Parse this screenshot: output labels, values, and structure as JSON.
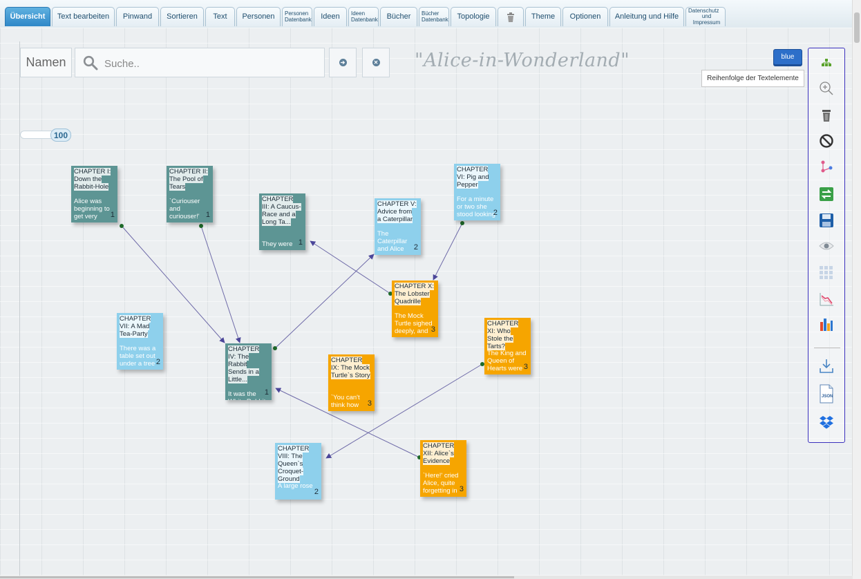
{
  "tabs": [
    {
      "label": "Übersicht",
      "active": true
    },
    {
      "label": "Text bearbeiten"
    },
    {
      "label": "Pinwand"
    },
    {
      "label": "Sortieren"
    },
    {
      "label": "Text"
    },
    {
      "label": "Personen"
    },
    {
      "label": "Personen",
      "label2": "Datenbank"
    },
    {
      "label": "Ideen"
    },
    {
      "label": "Ideen",
      "label2": "Datenbank"
    },
    {
      "label": "Bücher"
    },
    {
      "label": "Bücher",
      "label2": "Datenbank"
    },
    {
      "label": "Topologie"
    },
    {
      "icon": "trash-icon"
    },
    {
      "label": "Theme"
    },
    {
      "label": "Optionen"
    },
    {
      "label": "Anleitung und Hilfe"
    },
    {
      "label": "Datenschutz",
      "label2": "und Impressum"
    }
  ],
  "search": {
    "names_label": "Namen",
    "placeholder": "Suche.."
  },
  "document_title": "\"Alice-in-Wonderland\"",
  "theme_button": "blue",
  "tooltip": "Reihenfolge der Textelemente",
  "zoom": {
    "value": "100"
  },
  "toolbar": {
    "icons": [
      "hierarchy-icon",
      "zoom-in-icon",
      "trash-can-icon",
      "forbidden-icon",
      "graph-nodes-icon",
      "swap-icon",
      "save-icon",
      "eye-icon",
      "grid-icon",
      "chart-down-icon",
      "bar-chart-icon",
      "download-icon",
      "json-file-icon",
      "dropbox-icon"
    ]
  },
  "nodes": [
    {
      "id": "c1",
      "title": "CHAPTER I: Down the Rabbit-Hole",
      "excerpt": "Alice was beginning to get very",
      "num": "1",
      "color": "teal"
    },
    {
      "id": "c2",
      "title": "CHAPTER II: The Pool of Tears",
      "excerpt": "`Curiouser and curiouser!'",
      "num": "1",
      "color": "teal"
    },
    {
      "id": "c3",
      "title": "CHAPTER III: A Caucus-Race and a Long Ta...",
      "excerpt": "They were",
      "num": "1",
      "color": "teal"
    },
    {
      "id": "c4",
      "title": "CHAPTER IV: The Rabbit Sends in a Little...",
      "excerpt": "It was the White Rabbit,",
      "num": "1",
      "color": "teal"
    },
    {
      "id": "c5",
      "title": "CHAPTER V: Advice from a Caterpillar",
      "excerpt": "The Caterpillar and Alice",
      "num": "2",
      "color": "light"
    },
    {
      "id": "c6",
      "title": "CHAPTER VI: Pig and Pepper",
      "excerpt": "For a minute or two she stood looking",
      "num": "2",
      "color": "light"
    },
    {
      "id": "c7",
      "title": "CHAPTER VII: A Mad Tea-Party",
      "excerpt": "There was a table set out under a tree",
      "num": "2",
      "color": "light"
    },
    {
      "id": "c8",
      "title": "CHAPTER VIII: The Queen`s Croquet-Ground",
      "excerpt": "A large rose",
      "num": "2",
      "color": "light"
    },
    {
      "id": "c9",
      "title": "CHAPTER IX: The Mock Turtle`s Story",
      "excerpt": "`You can't think how",
      "num": "3",
      "color": "orange"
    },
    {
      "id": "c10",
      "title": "CHAPTER X: The Lobster Quadrille",
      "excerpt": "The Mock Turtle sighed deeply, and",
      "num": "3",
      "color": "orange"
    },
    {
      "id": "c11",
      "title": "CHAPTER XI: Who Stole the Tarts?",
      "excerpt": "The King and Queen of Hearts were",
      "num": "3",
      "color": "orange"
    },
    {
      "id": "c12",
      "title": "CHAPTER XII: Alice`s Evidence",
      "excerpt": "`Here!' cried Alice, quite forgetting in",
      "num": "3",
      "color": "orange"
    }
  ],
  "edges": [
    [
      "c1",
      "c4"
    ],
    [
      "c2",
      "c4"
    ],
    [
      "c4",
      "c5"
    ],
    [
      "c10",
      "c3"
    ],
    [
      "c6",
      "c10"
    ],
    [
      "c11",
      "c8"
    ],
    [
      "c12",
      "c4"
    ]
  ],
  "colors": {
    "teal": "#5d9594",
    "light": "#8ed0ec",
    "orange": "#f6a500",
    "edge": "#6e6aa8",
    "toolbar_border": "#3a2fbd",
    "active_tab": "#2f88c8"
  }
}
